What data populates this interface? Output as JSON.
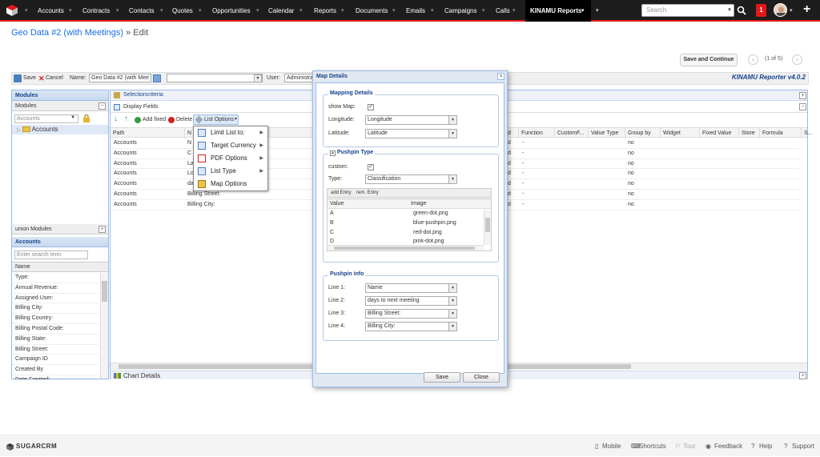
{
  "nav": {
    "items": [
      "Accounts",
      "Contracts",
      "Contacts",
      "Quotes",
      "Opportunities",
      "Calendar",
      "Reports",
      "Documents",
      "Emails",
      "Campaigns",
      "Calls"
    ],
    "active_item": "KINAMU Reports",
    "search_placeholder": "Search",
    "notification_count": "1",
    "plus_icon": "+",
    "colors": {
      "bar": "#1d1d1d",
      "accent": "#e61718"
    }
  },
  "header": {
    "title": "Geo Data #2 (with Meetings)",
    "separator": "»",
    "mode": "Edit",
    "save_continue": "Save and Continue",
    "pager": "(1 of 5)"
  },
  "toolbar": {
    "save": "Save",
    "cancel": "Cancel",
    "name_label": "Name:",
    "name_value": "Geo Data #2 (with Mee",
    "user_label": "User:",
    "user_value": "Administrat",
    "brand": "KINAMU Reporter v4.0.2"
  },
  "left": {
    "modules_header": "Modules",
    "modules_sub": "Modules",
    "module_select": "Accounts",
    "tree_item": "Accounts",
    "union_modules": "union Modules",
    "accounts_header": "Accounts",
    "search_placeholder": "Enter search term",
    "name_col": "Name",
    "fields": [
      "Type:",
      "Annual Revenue:",
      "Assigned User:",
      "Billing City:",
      "Billing Country:",
      "Billing Postal Code:",
      "Billing State:",
      "Billing Street:",
      "Campaign ID",
      "Created By",
      "Date Created:"
    ]
  },
  "main": {
    "selection_criteria": "Selectioncriteria",
    "display_fields": "Display Fields",
    "add_fixed": "Add fixed",
    "delete": "Delete",
    "list_options": "List Options",
    "columns_left": [
      "Path",
      "N"
    ],
    "columns_right": [
      "d",
      "Function",
      "CustomF...",
      "Value Type",
      "Group by",
      "Widget",
      "Fixed Value",
      "Store",
      "Formula",
      "S..."
    ],
    "rows": [
      {
        "path": "Accounts",
        "name": "N",
        "d": "d",
        "fn": "-",
        "group": "no"
      },
      {
        "path": "Accounts",
        "name": "C",
        "d": "d",
        "fn": "-",
        "group": "no"
      },
      {
        "path": "Accounts",
        "name": "La",
        "d": "d",
        "fn": "-",
        "group": "no"
      },
      {
        "path": "Accounts",
        "name": "Lo",
        "d": "d",
        "fn": "-",
        "group": "no"
      },
      {
        "path": "Accounts",
        "name": "da",
        "d": "d",
        "fn": "-",
        "group": "no"
      },
      {
        "path": "Accounts",
        "name": "Billing Street:",
        "d": "d",
        "fn": "-",
        "group": "no"
      },
      {
        "path": "Accounts",
        "name": "Billing City:",
        "d": "d",
        "fn": "-",
        "group": "no"
      }
    ],
    "chart_details": "Chart Details"
  },
  "dropdown": {
    "items": [
      "Limit List to:",
      "Target Currency",
      "PDF Options",
      "List Type",
      "Map Options"
    ]
  },
  "modal": {
    "title": "Map Details",
    "close": "×",
    "mapping": {
      "legend": "Mapping Details",
      "show_map_label": "show Map:",
      "longitude_label": "Longitude:",
      "longitude_value": "Longitude",
      "latitude_label": "Latitude:",
      "latitude_value": "Latitude"
    },
    "pushpin_type": {
      "legend": "Pushpin Type",
      "custom_label": "custom:",
      "type_label": "Type:",
      "type_value": "Classification",
      "add_entry": "add Entry",
      "rem_entry": "rem. Entry",
      "col_value": "Value",
      "col_image": "Image",
      "rows": [
        {
          "value": "A",
          "image": "green-dot.png"
        },
        {
          "value": "B",
          "image": "blue-pushpin.png"
        },
        {
          "value": "C",
          "image": "red-dot.png"
        },
        {
          "value": "D",
          "image": "pink-dot.png"
        }
      ]
    },
    "pushpin_info": {
      "legend": "Pushpin info",
      "lines": [
        {
          "label": "Line 1:",
          "value": "Name"
        },
        {
          "label": "Line 2:",
          "value": "days to next meeting"
        },
        {
          "label": "Line 3:",
          "value": "Billing Street:"
        },
        {
          "label": "Line 4:",
          "value": "Billing City:"
        }
      ]
    },
    "save": "Save",
    "close_btn": "Close"
  },
  "footer": {
    "brand": "SUGARCRM",
    "links": [
      "Mobile",
      "Shortcuts",
      "Tour",
      "Feedback",
      "Help",
      "Support"
    ]
  }
}
